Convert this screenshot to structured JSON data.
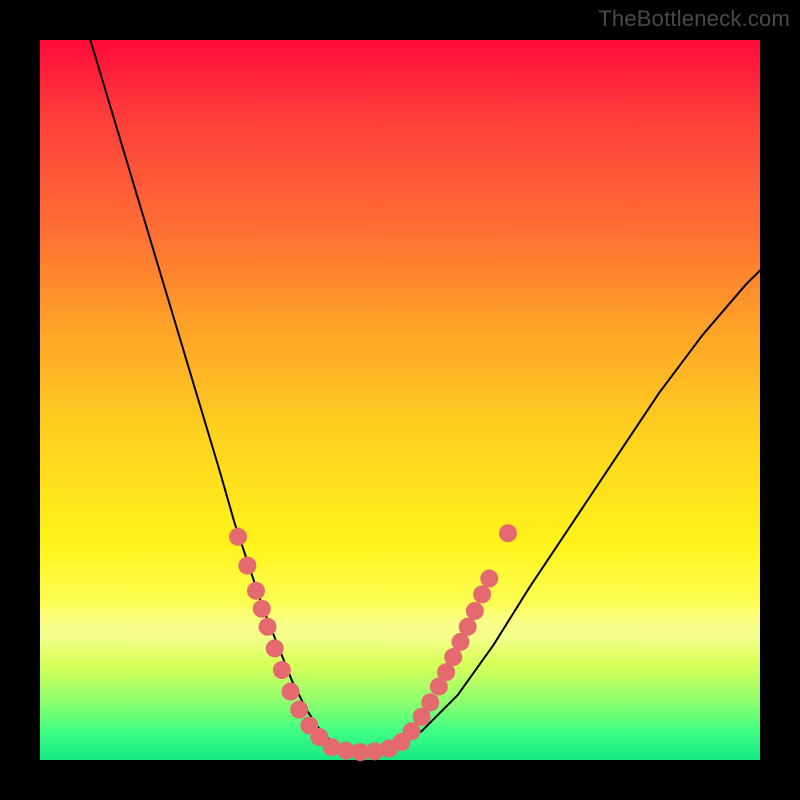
{
  "watermark": "TheBottleneck.com",
  "chart_data": {
    "type": "line",
    "title": "",
    "xlabel": "",
    "ylabel": "",
    "xlim": [
      0,
      100
    ],
    "ylim": [
      0,
      100
    ],
    "grid": false,
    "legend": false,
    "series": [
      {
        "name": "bottleneck-curve",
        "x": [
          7,
          10,
          13,
          16,
          19,
          22,
          25,
          27,
          29,
          31,
          33,
          35,
          37,
          39,
          41,
          44,
          48,
          53,
          58,
          63,
          68,
          74,
          80,
          86,
          92,
          98,
          100
        ],
        "y": [
          100,
          90,
          80,
          70,
          60,
          50,
          40,
          33,
          27,
          21,
          16,
          11,
          7,
          4,
          2,
          1,
          1,
          4,
          9,
          16,
          24,
          33,
          42,
          51,
          59,
          66,
          68
        ],
        "color": "#000000",
        "width": 2
      }
    ],
    "markers": [
      {
        "name": "left-branch-dots",
        "color": "#e46a6f",
        "radius": 9,
        "points": [
          {
            "x": 27.5,
            "y": 31
          },
          {
            "x": 28.8,
            "y": 27
          },
          {
            "x": 30.0,
            "y": 23.5
          },
          {
            "x": 30.8,
            "y": 21
          },
          {
            "x": 31.6,
            "y": 18.5
          },
          {
            "x": 32.6,
            "y": 15.5
          },
          {
            "x": 33.6,
            "y": 12.5
          },
          {
            "x": 34.8,
            "y": 9.5
          },
          {
            "x": 36.0,
            "y": 7
          },
          {
            "x": 37.4,
            "y": 4.8
          },
          {
            "x": 38.8,
            "y": 3.2
          }
        ]
      },
      {
        "name": "valley-dots",
        "color": "#e46a6f",
        "radius": 9,
        "points": [
          {
            "x": 40.5,
            "y": 1.8
          },
          {
            "x": 42.5,
            "y": 1.3
          },
          {
            "x": 44.5,
            "y": 1.1
          },
          {
            "x": 46.5,
            "y": 1.2
          },
          {
            "x": 48.5,
            "y": 1.6
          }
        ]
      },
      {
        "name": "right-branch-dots",
        "color": "#e46a6f",
        "radius": 9,
        "points": [
          {
            "x": 50.2,
            "y": 2.5
          },
          {
            "x": 51.6,
            "y": 4.0
          },
          {
            "x": 53.0,
            "y": 6.0
          },
          {
            "x": 54.2,
            "y": 8.0
          },
          {
            "x": 55.4,
            "y": 10.2
          },
          {
            "x": 56.4,
            "y": 12.2
          },
          {
            "x": 57.4,
            "y": 14.3
          },
          {
            "x": 58.4,
            "y": 16.4
          },
          {
            "x": 59.4,
            "y": 18.5
          },
          {
            "x": 60.4,
            "y": 20.7
          },
          {
            "x": 61.4,
            "y": 23.0
          },
          {
            "x": 62.4,
            "y": 25.2
          },
          {
            "x": 65.0,
            "y": 31.5
          }
        ]
      }
    ]
  }
}
